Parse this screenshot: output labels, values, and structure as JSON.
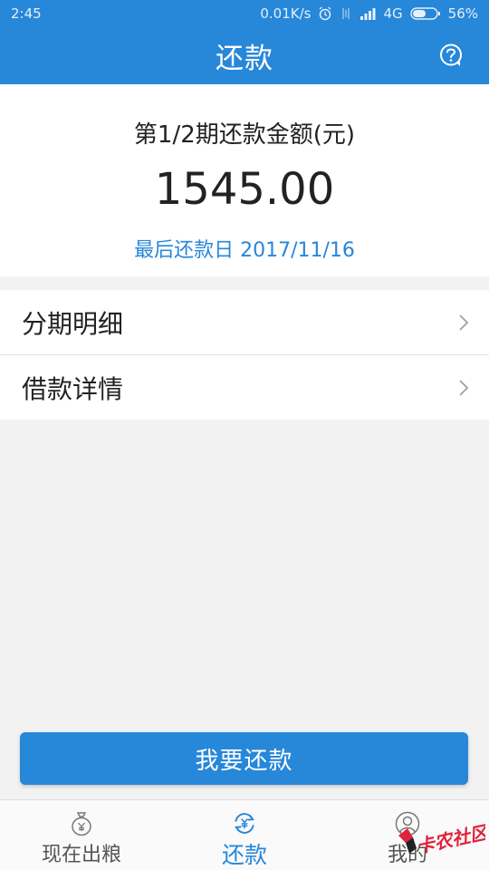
{
  "status_bar": {
    "time": "2:45",
    "net_speed": "0.01K/s",
    "network": "4G",
    "battery": "56%",
    "battery_level": 0.56
  },
  "header": {
    "title": "还款",
    "help_icon": "question-circle-icon"
  },
  "summary": {
    "period_label": "第1/2期还款金额(元)",
    "amount": "1545.00",
    "due_date": "最后还款日 2017/11/16"
  },
  "menu": {
    "items": [
      {
        "label": "分期明细",
        "icon": "chevron-right-icon"
      },
      {
        "label": "借款详情",
        "icon": "chevron-right-icon"
      }
    ]
  },
  "actions": {
    "repay_label": "我要还款"
  },
  "tabbar": {
    "tabs": [
      {
        "label": "现在出粮",
        "icon": "money-bag-icon",
        "active": false
      },
      {
        "label": "还款",
        "icon": "refresh-yen-icon",
        "active": true
      },
      {
        "label": "我的",
        "icon": "user-icon",
        "active": false
      }
    ]
  },
  "watermark": {
    "text": "卡农社区"
  },
  "colors": {
    "primary": "#2787d9",
    "background": "#f2f2f2",
    "watermark": "#e0233a"
  }
}
